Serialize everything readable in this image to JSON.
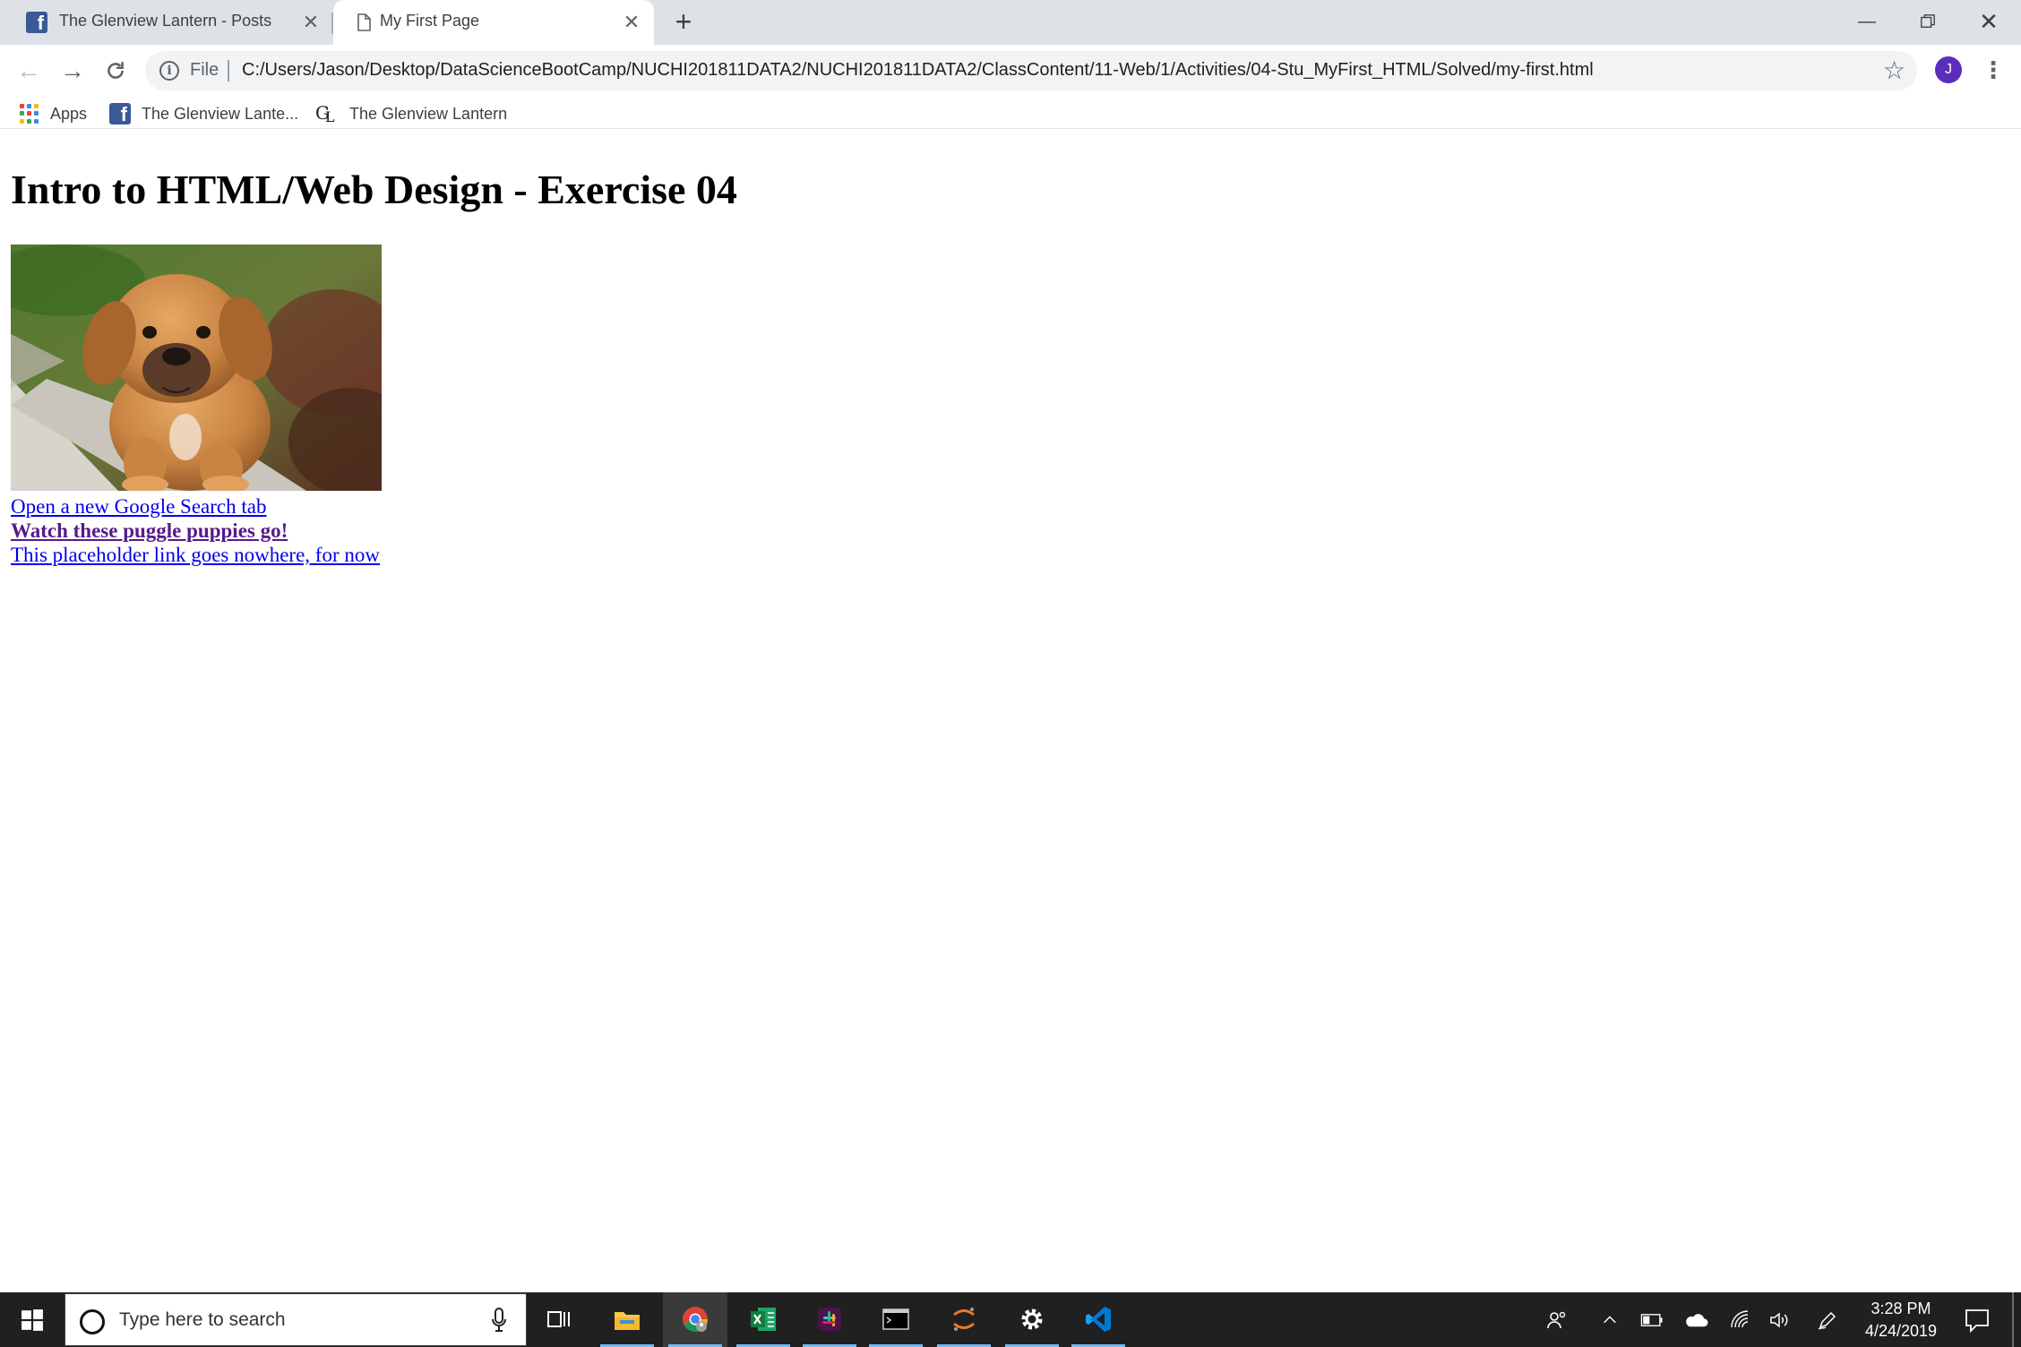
{
  "browser": {
    "tabs": [
      {
        "title": "The Glenview Lantern - Posts",
        "icon": "facebook-icon",
        "active": false
      },
      {
        "title": "My First Page",
        "icon": "page-icon",
        "active": true
      }
    ],
    "new_tab_glyph": "+",
    "omnibox": {
      "scheme_label": "File",
      "url": "C:/Users/Jason/Desktop/DataScienceBootCamp/NUCHI201811DATA2/NUCHI201811DATA2/ClassContent/11-Web/1/Activities/04-Stu_MyFirst_HTML/Solved/my-first.html"
    },
    "profile_initial": "J",
    "bookmarks": [
      {
        "label": "Apps",
        "icon": "apps-grid-icon"
      },
      {
        "label": "The Glenview Lante...",
        "icon": "facebook-icon"
      },
      {
        "label": "The Glenview Lantern",
        "icon": "glenview-lantern-logo-icon"
      }
    ]
  },
  "page": {
    "heading": "Intro to HTML/Web Design - Exercise 04",
    "image_subject": "puggle-puppy-photo",
    "links": [
      "Open a new Google Search tab",
      "Watch these puggle puppies go!",
      "This placeholder link goes nowhere, for now"
    ]
  },
  "taskbar": {
    "search_placeholder": "Type here to search",
    "apps": [
      "task-view-icon",
      "file-explorer-icon",
      "chrome-icon",
      "excel-icon",
      "slack-icon",
      "terminal-icon",
      "jupyter-icon",
      "settings-icon",
      "vscode-icon"
    ],
    "clock": {
      "time": "3:28 PM",
      "date": "4/24/2019"
    }
  },
  "colors": {
    "tabstrip": "#dee1e6",
    "link": "#0000ee",
    "visited_link": "#551a8b",
    "taskbar": "#202020",
    "facebook_blue": "#3b5998",
    "profile_purple": "#5b2dbb"
  }
}
